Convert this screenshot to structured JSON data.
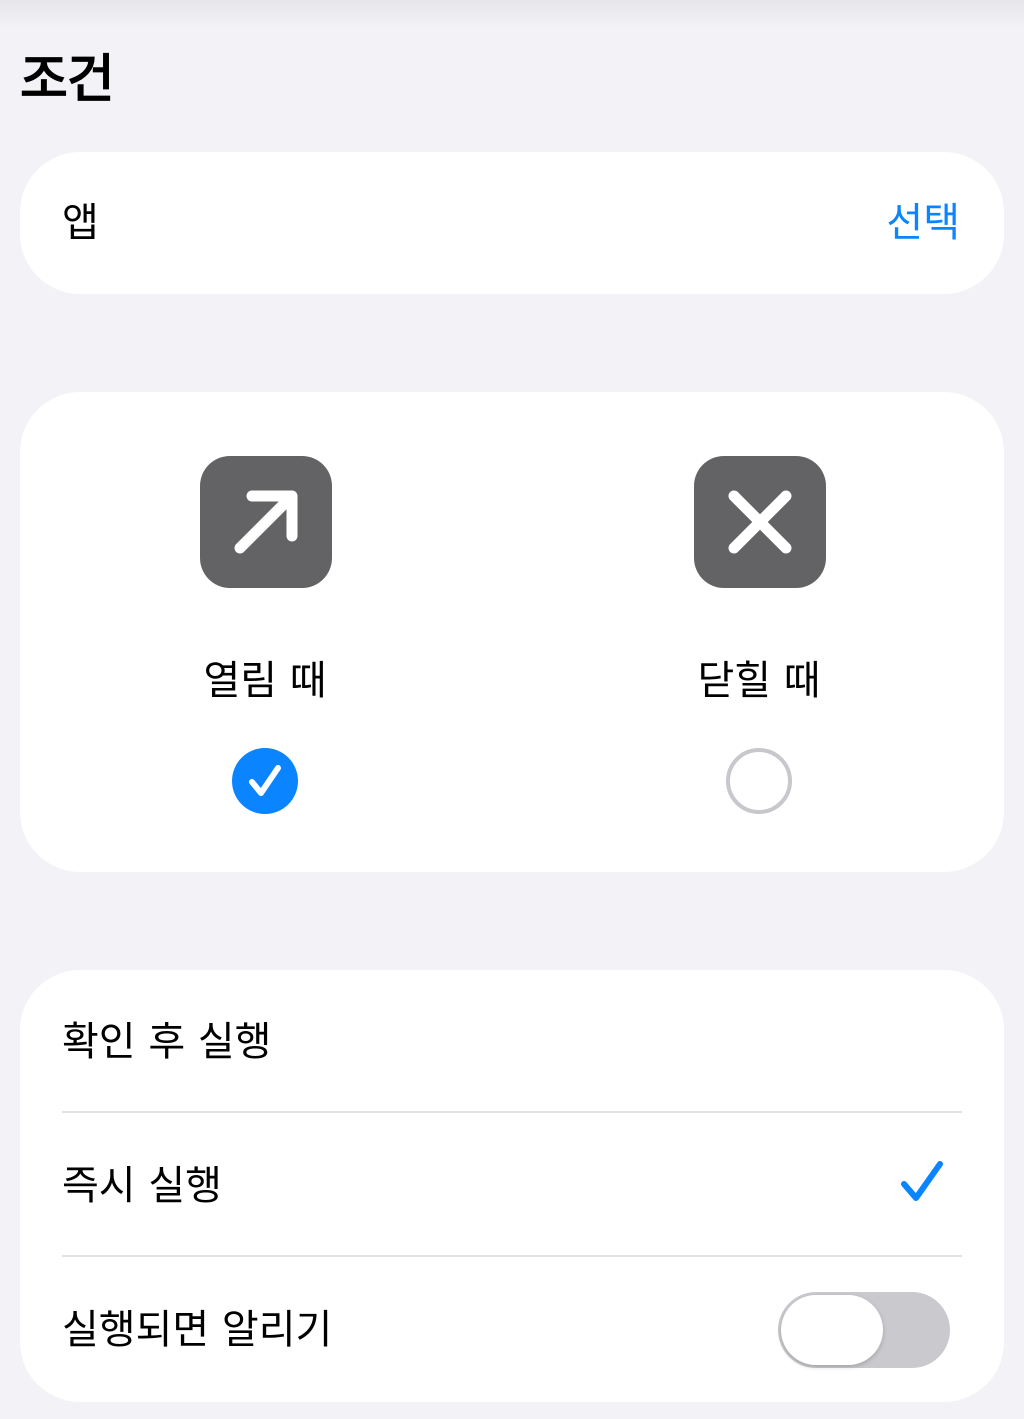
{
  "header": {
    "title": "조건"
  },
  "app_section": {
    "label": "앱",
    "select_label": "선택"
  },
  "trigger_section": {
    "options": [
      {
        "label": "열림 때",
        "icon": "arrow-up-right-icon",
        "selected": true
      },
      {
        "label": "닫힐 때",
        "icon": "xmark-icon",
        "selected": false
      }
    ]
  },
  "run_section": {
    "rows": [
      {
        "label": "확인 후 실행",
        "checked": false
      },
      {
        "label": "즉시 실행",
        "checked": true
      },
      {
        "label": "실행되면 알리기",
        "toggle_on": false
      }
    ]
  },
  "colors": {
    "background": "#f2f2f7",
    "accent": "#0a84ff",
    "tile": "#636366",
    "toggle_off": "#c9c9ce"
  }
}
